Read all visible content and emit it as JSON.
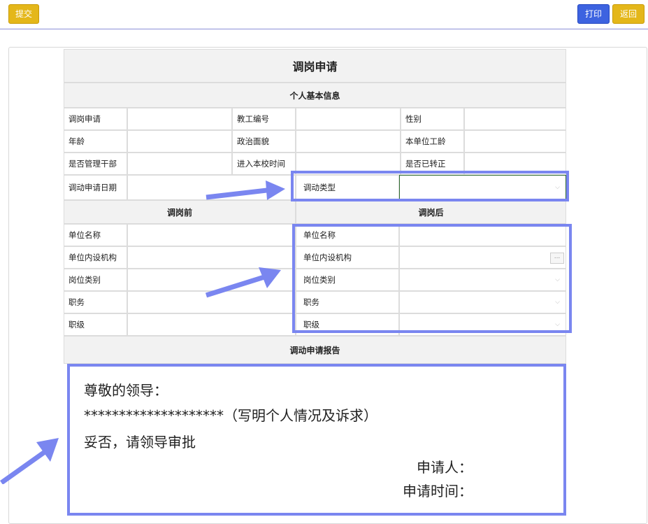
{
  "toolbar": {
    "submit_label": "提交",
    "print_label": "打印",
    "back_label": "返回"
  },
  "form": {
    "title": "调岗申请",
    "section_basic": "个人基本信息",
    "labels": {
      "apply": "调岗申请",
      "staff_no": "教工编号",
      "gender": "性别",
      "age": "年龄",
      "politics": "政治面貌",
      "seniority": "本单位工龄",
      "is_cadre": "是否管理干部",
      "join_date": "进入本校时间",
      "regularized": "是否已转正",
      "transfer_date": "调动申请日期",
      "transfer_type": "调动类型"
    },
    "before_header": "调岗前",
    "after_header": "调岗后",
    "before_labels": [
      "单位名称",
      "单位内设机构",
      "岗位类别",
      "职务",
      "职级"
    ],
    "after_labels": [
      "单位名称",
      "单位内设机构",
      "岗位类别",
      "职务",
      "职级"
    ],
    "section_report": "调动申请报告",
    "dots_label": "..."
  },
  "report": {
    "line1": "尊敬的领导：",
    "line2": "********************（写明个人情况及诉求）",
    "line3": "妥否，请领导审批",
    "applicant": "申请人：",
    "apply_time": "申请时间："
  },
  "colors": {
    "highlight": "#7a86f0",
    "yellow_button": "#e4b71a",
    "blue_button": "#3d63e0",
    "header_bg": "#f2f2f2"
  }
}
